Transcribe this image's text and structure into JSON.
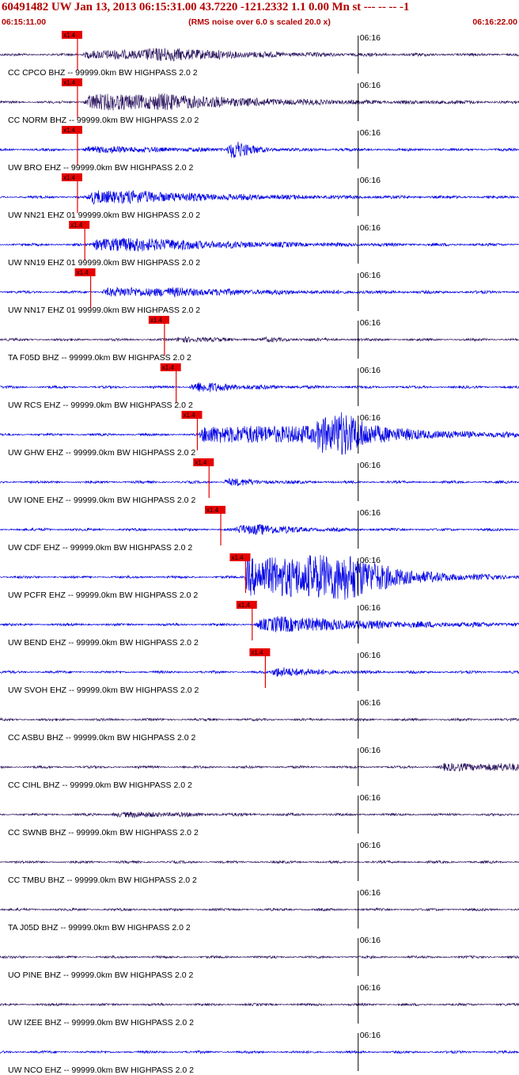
{
  "header": {
    "title": "60491482 UW Jan 13, 2013 06:15:31.00   43.7220 -121.2332  1.1 0.00 Mn st --- -- --  -1",
    "start_time": "06:15:11.00",
    "rms_note": "(RMS noise over 6.0 s scaled 20.0 x)",
    "end_time": "06:16:22.00"
  },
  "colors": {
    "header_text": "#b40000",
    "trace_blue": "#0000e6",
    "trace_purple": "#2e1860",
    "pick_marker": "#e60000",
    "label_text": "#000000"
  },
  "chart_data": {
    "type": "line",
    "x_range_seconds": [
      "06:15:11.00",
      "06:16:22.00"
    ],
    "minute_tick_label": "06:16",
    "pick_label": "x1.4",
    "traces": [
      {
        "label": "CC CPCO BHZ -- 99999.0km BW  HIGHPASS  2.0  2",
        "color": "purple",
        "pick": "06:15:21.6",
        "env": [
          [
            0.8,
            11.2,
            13.0,
            12.0,
            0.5
          ],
          [
            1.2,
            19.0,
            9.0,
            6.0,
            0.3
          ]
        ]
      },
      {
        "label": "CC NORM BHZ -- 99999.0km BW  HIGHPASS  2.0  2",
        "color": "purple",
        "pick": "06:15:21.6",
        "env": [
          [
            0.9,
            11.4,
            14.0,
            7.0,
            1.0
          ],
          [
            1.0,
            21.0,
            12.0,
            0.0,
            0.4
          ],
          [
            1.4,
            58.0,
            3.0,
            0.0,
            0.2
          ]
        ]
      },
      {
        "label": "UW BRO EHZ -- 99999.0km BW  HIGHPASS  2.0  2",
        "color": "blue",
        "pick": "06:15:21.6",
        "env": [
          [
            1.0,
            11.2,
            14.0,
            4.0,
            0.3
          ],
          [
            1.0,
            31.0,
            2.0,
            0.0,
            2.2
          ],
          [
            0.9,
            15.0,
            1.0,
            0.0,
            0.5
          ],
          [
            2.0,
            45.5,
            0.4,
            0.0,
            0.4
          ]
        ]
      },
      {
        "label": "UW NN21 EHZ 01 99999.0km BW  HIGHPASS  2.0  2",
        "color": "blue",
        "pick": "06:15:21.6",
        "env": [
          [
            0.9,
            11.8,
            14.0,
            6.0,
            0.8
          ]
        ]
      },
      {
        "label": "UW NN19 EHZ 01 99999.0km BW  HIGHPASS  2.0  2",
        "color": "blue",
        "pick": "06:15:22.6",
        "env": [
          [
            0.9,
            12.5,
            13.0,
            8.0,
            0.8
          ]
        ]
      },
      {
        "label": "UW NN17 EHZ 01 99999.0km BW  HIGHPASS  2.0  2",
        "color": "blue",
        "pick": "06:15:23.4",
        "env": [
          [
            0.8,
            13.8,
            14.0,
            10.0,
            0.5
          ]
        ]
      },
      {
        "label": "TA F05D BHZ -- 99999.0km BW  HIGHPASS  2.0  2",
        "color": "purple",
        "pick": "06:15:33.5",
        "env": [
          [
            0.9,
            24.0,
            4.0,
            0.0,
            0.5
          ],
          [
            0.6,
            35.5,
            5.0,
            0.0,
            0.2
          ]
        ]
      },
      {
        "label": "UW RCS EHZ -- 99999.0km BW  HIGHPASS  2.0  2",
        "color": "blue",
        "pick": "06:15:35.1",
        "env": [
          [
            0.9,
            25.8,
            6.0,
            2.0,
            0.6
          ]
        ]
      },
      {
        "label": "UW GHW EHZ -- 99999.0km BW  HIGHPASS  2.0  2",
        "color": "blue",
        "pick": "06:15:38.0",
        "env": [
          [
            0.8,
            27.2,
            18.0,
            14.0,
            1.1
          ],
          [
            1.0,
            43.0,
            4.0,
            0.0,
            2.2
          ],
          [
            1.0,
            45.5,
            3.0,
            0.0,
            2.6
          ]
        ]
      },
      {
        "label": "UW IONE EHZ -- 99999.0km BW  HIGHPASS  2.0  2",
        "color": "blue",
        "pick": "06:15:39.6",
        "env": [
          [
            0.5,
            30.5,
            4.0,
            2.0,
            0.4
          ]
        ]
      },
      {
        "label": "UW CDF EHZ -- 99999.0km BW  HIGHPASS  2.0  2",
        "color": "blue",
        "pick": "06:15:41.2",
        "env": [
          [
            0.9,
            32.0,
            6.0,
            3.0,
            0.5
          ],
          [
            1.0,
            34.5,
            3.0,
            0.0,
            0.4
          ],
          [
            1.0,
            5.5,
            0.5,
            0.0,
            0.5
          ]
        ]
      },
      {
        "label": "UW PCFR EHZ -- 99999.0km BW  HIGHPASS  2.0  2",
        "color": "blue",
        "pick": "06:15:44.6",
        "env": [
          [
            0.3,
            33.5,
            10.0,
            7.0,
            2.6
          ],
          [
            0.4,
            42.0,
            4.5,
            4.0,
            2.6
          ],
          [
            1.0,
            47.0,
            4.0,
            0.0,
            0.6
          ]
        ]
      },
      {
        "label": "UW BEND EHZ -- 99999.0km BW  HIGHPASS  2.0  2",
        "color": "blue",
        "pick": "06:15:45.5",
        "env": [
          [
            0.9,
            34.8,
            16.0,
            8.0,
            0.7
          ],
          [
            1.0,
            37.0,
            4.0,
            0.0,
            0.5
          ]
        ]
      },
      {
        "label": "UW SVOH EHZ -- 99999.0km BW  HIGHPASS  2.0  2",
        "color": "blue",
        "pick": "06:15:47.3",
        "env": [
          [
            0.8,
            37.0,
            5.0,
            2.0,
            0.6
          ]
        ]
      },
      {
        "label": "CC ASBU BHZ -- 99999.0km BW  HIGHPASS  2.0  2",
        "color": "purple",
        "pick": null,
        "env": []
      },
      {
        "label": "CC CIHL BHZ -- 99999.0km BW  HIGHPASS  2.0  2",
        "color": "purple",
        "pick": null,
        "env": [
          [
            0.8,
            60.0,
            15.0,
            10.0,
            0.4
          ]
        ]
      },
      {
        "label": "CC SWNB BHZ -- 99999.0km BW  HIGHPASS  2.0  2",
        "color": "purple",
        "pick": null,
        "env": [
          [
            0.8,
            15.0,
            8.0,
            6.0,
            0.25
          ]
        ]
      },
      {
        "label": "CC TMBU BHZ -- 99999.0km BW  HIGHPASS  2.0  2",
        "color": "purple",
        "pick": null,
        "env": []
      },
      {
        "label": "TA J05D BHZ -- 99999.0km BW  HIGHPASS  2.0  2",
        "color": "purple",
        "pick": null,
        "env": []
      },
      {
        "label": "UO PINE BHZ -- 99999.0km BW  HIGHPASS  2.0  2",
        "color": "purple",
        "pick": null,
        "env": []
      },
      {
        "label": "UW IZEE BHZ -- 99999.0km BW  HIGHPASS  2.0  2",
        "color": "purple",
        "pick": null,
        "env": []
      },
      {
        "label": "UW NCO EHZ -- 99999.0km BW  HIGHPASS  2.0  2",
        "color": "blue",
        "pick": null,
        "env": []
      }
    ]
  }
}
